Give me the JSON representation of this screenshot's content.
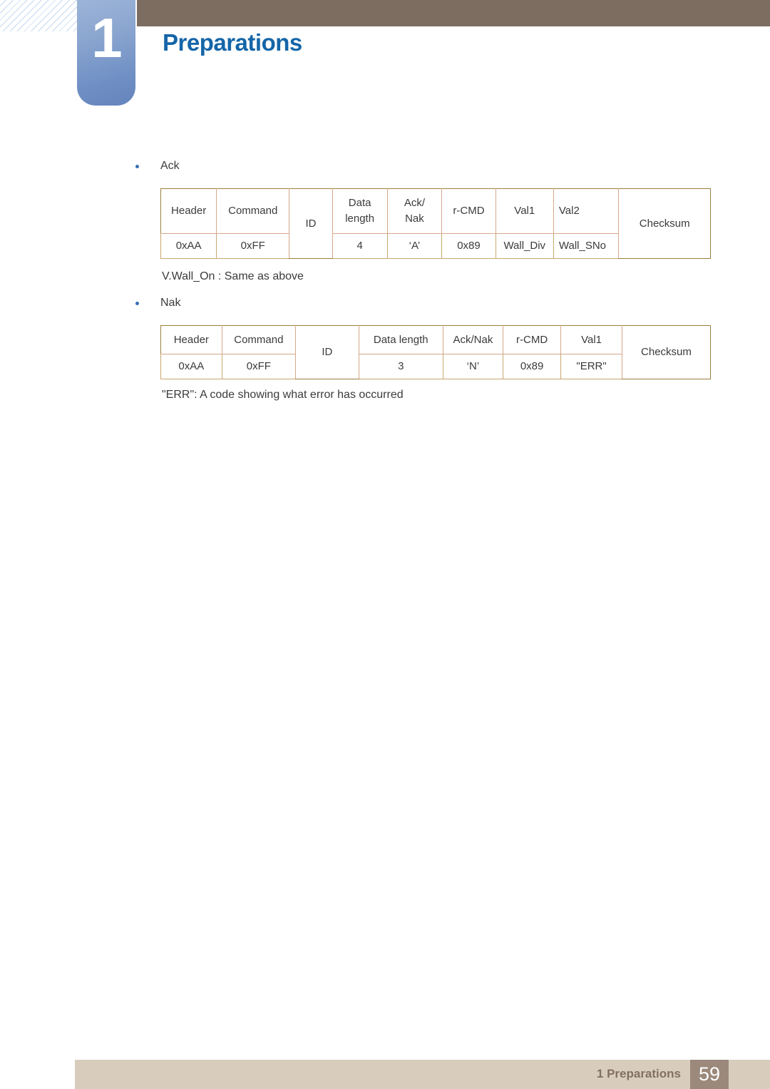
{
  "header": {
    "chapter_number": "1",
    "title": "Preparations",
    "accent_blue": "#1565a8",
    "badge_blue": "#6f8fc4",
    "bar_brown": "#7c6d60"
  },
  "body": {
    "bullet_ack": "Ack",
    "note_wall_on": "V.Wall_On : Same as above",
    "bullet_nak": "Nak",
    "note_err": "\"ERR\": A code showing what error has occurred"
  },
  "ack_table": {
    "caption": "Ack",
    "header_row": [
      "Header",
      "Command",
      "ID",
      "Data length",
      "Ack/ Nak",
      "r-CMD",
      "Val1",
      "Val2",
      "Checksum"
    ],
    "header_row_line1": {
      "data_length": "Data",
      "ack_nak": "Ack/",
      "val1": "Val1",
      "val2": "Val2"
    },
    "header_row_line2": {
      "data_length": "length",
      "ack_nak": "Nak"
    },
    "header_labels": {
      "header": "Header",
      "command": "Command",
      "id": "ID",
      "r_cmd": "r-CMD",
      "checksum": "Checksum"
    },
    "value_row": {
      "header": "0xAA",
      "command": "0xFF",
      "data_length": "4",
      "ack_nak": "‘A’",
      "r_cmd": "0x89",
      "val1": "Wall_Div",
      "val2": "Wall_SNo"
    }
  },
  "nak_table": {
    "caption": "Nak",
    "header_labels": {
      "header": "Header",
      "command": "Command",
      "id": "ID",
      "data_length": "Data length",
      "ack_nak": "Ack/Nak",
      "r_cmd": "r-CMD",
      "val1": "Val1",
      "checksum": "Checksum"
    },
    "value_row": {
      "header": "0xAA",
      "command": "0xFF",
      "data_length": "3",
      "ack_nak": "‘N’",
      "r_cmd": "0x89",
      "val1": "\"ERR\""
    }
  },
  "footer": {
    "chapter_label": "1 Preparations",
    "page_number": "59",
    "bar_color": "#d8cdbd",
    "page_box_color": "#9b897b"
  }
}
